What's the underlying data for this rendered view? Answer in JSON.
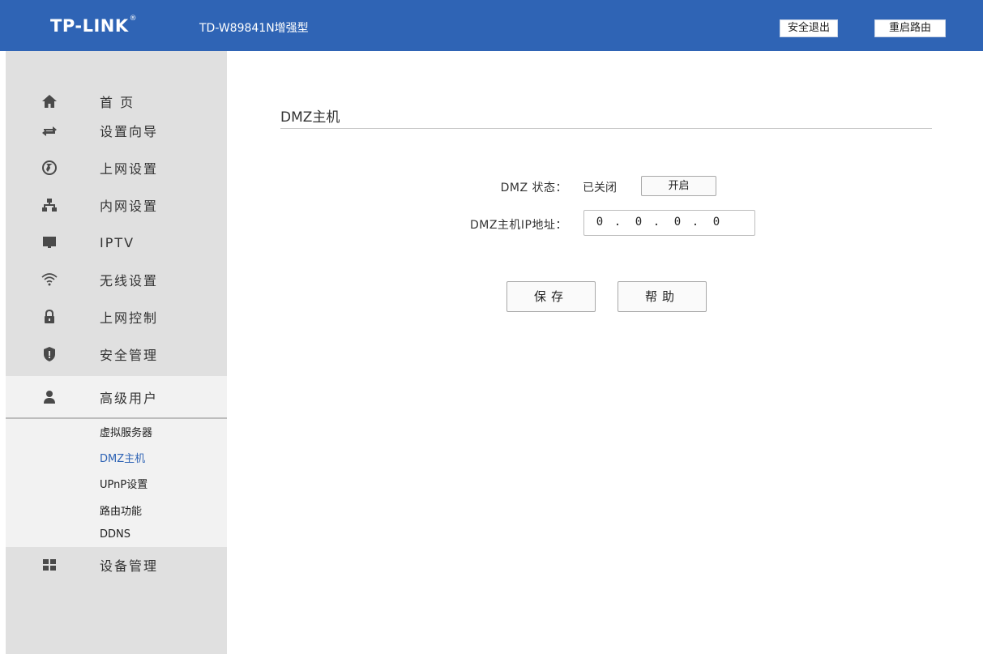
{
  "header": {
    "logo": "TP-LINK",
    "logo_mark": "®",
    "model": "TD-W89841N增强型",
    "logout_label": "安全退出",
    "reboot_label": "重启路由",
    "bg_color": "#2f64b5"
  },
  "sidebar": {
    "items": [
      {
        "label": "首 页",
        "icon": "home-icon"
      },
      {
        "label": "设置向导",
        "icon": "arrows-icon"
      },
      {
        "label": "上网设置",
        "icon": "globe-icon"
      },
      {
        "label": "内网设置",
        "icon": "network-icon"
      },
      {
        "label": "IPTV",
        "icon": "monitor-icon"
      },
      {
        "label": "无线设置",
        "icon": "wifi-icon"
      },
      {
        "label": "上网控制",
        "icon": "lock-icon"
      },
      {
        "label": "安全管理",
        "icon": "shield-icon"
      },
      {
        "label": "高级用户",
        "icon": "user-icon"
      },
      {
        "label": "设备管理",
        "icon": "grid-icon"
      }
    ],
    "active": "高级用户",
    "subitems": [
      {
        "label": "虚拟服务器"
      },
      {
        "label": "DMZ主机"
      },
      {
        "label": "UPnP设置"
      },
      {
        "label": "路由功能"
      },
      {
        "label": "DDNS"
      }
    ],
    "current_sub": "DMZ主机"
  },
  "main": {
    "title": "DMZ主机",
    "status_label": "DMZ 状态：",
    "status_value": "已关闭",
    "toggle_label": "开启",
    "ip_label": "DMZ主机IP地址：",
    "ip_octets": [
      "0",
      "0",
      "0",
      "0"
    ],
    "ip_separator": ".",
    "save_label": "保存",
    "help_label": "帮助"
  }
}
